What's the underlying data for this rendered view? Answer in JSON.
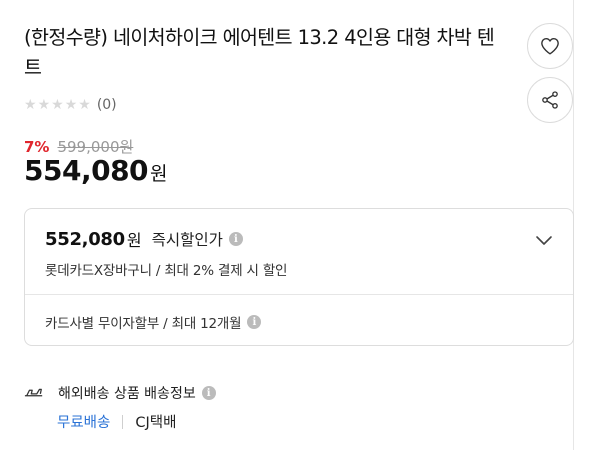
{
  "product": {
    "title": "(한정수량) 네이처하이크 에어텐트 13.2 4인용 대형 차박 텐트",
    "rating": {
      "stars": 0,
      "max_stars": 5,
      "review_count": "(0)"
    },
    "price": {
      "discount_rate": "7%",
      "original_price": "599,000원",
      "final_price": "554,080",
      "currency_unit": "원"
    }
  },
  "actions": {
    "wishlist_icon": "heart-icon",
    "share_icon": "share-icon"
  },
  "card_benefit": {
    "instant_price": "552,080",
    "instant_unit": "원",
    "instant_label": "즉시할인가",
    "instant_desc": "롯데카드X장바구니 / 최대 2% 결제 시 할인",
    "installment": "카드사별 무이자할부 / 최대 12개월"
  },
  "shipping": {
    "title": "해외배송 상품 배송정보",
    "fee": "무료배송",
    "carrier": "CJ택배",
    "fee_color": "#2b73d6"
  },
  "colors": {
    "discount": "#e0262d",
    "muted": "#999999",
    "border": "#dddddd"
  }
}
